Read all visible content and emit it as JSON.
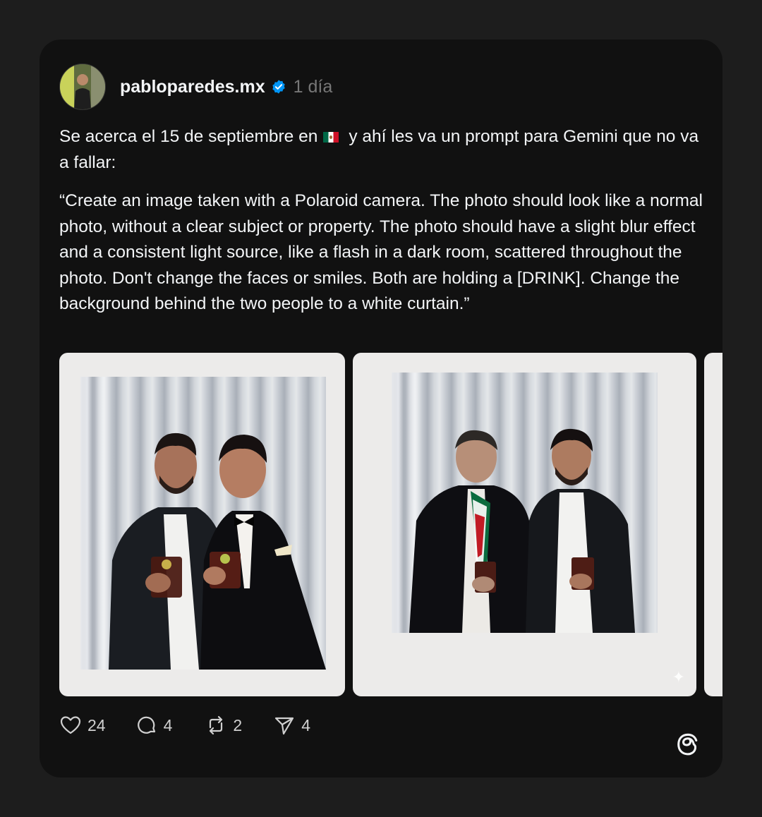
{
  "post": {
    "username": "pabloparedes.mx",
    "verified_icon": "verified-badge-icon",
    "time": "1 día",
    "text_line1_before_flag": "Se acerca el 15 de septiembre en",
    "flag_icon": "mexico-flag-emoji",
    "text_line1_after_flag": "y ahí les va un prompt para Gemini que no va a fallar:",
    "quote": "“Create an image taken with a Polaroid camera. The photo should look like a normal photo, without a clear subject or property. The photo should have a slight blur effect and a consistent light source, like a flash in a dark room, scattered throughout the photo. Don't change the faces or smiles. Both are holding a [DRINK]. Change the background behind the two people to a white curtain.”"
  },
  "media": {
    "images": [
      {
        "label": "polaroid-photo-1"
      },
      {
        "label": "polaroid-photo-2"
      },
      {
        "label": "polaroid-photo-3-partial"
      }
    ]
  },
  "actions": {
    "likes": "24",
    "comments": "4",
    "reposts": "2",
    "shares": "4"
  },
  "colors": {
    "background": "#1d1d1d",
    "card": "#111111",
    "text": "#f3f5f7",
    "muted": "#777777",
    "verified": "#0095f6"
  }
}
